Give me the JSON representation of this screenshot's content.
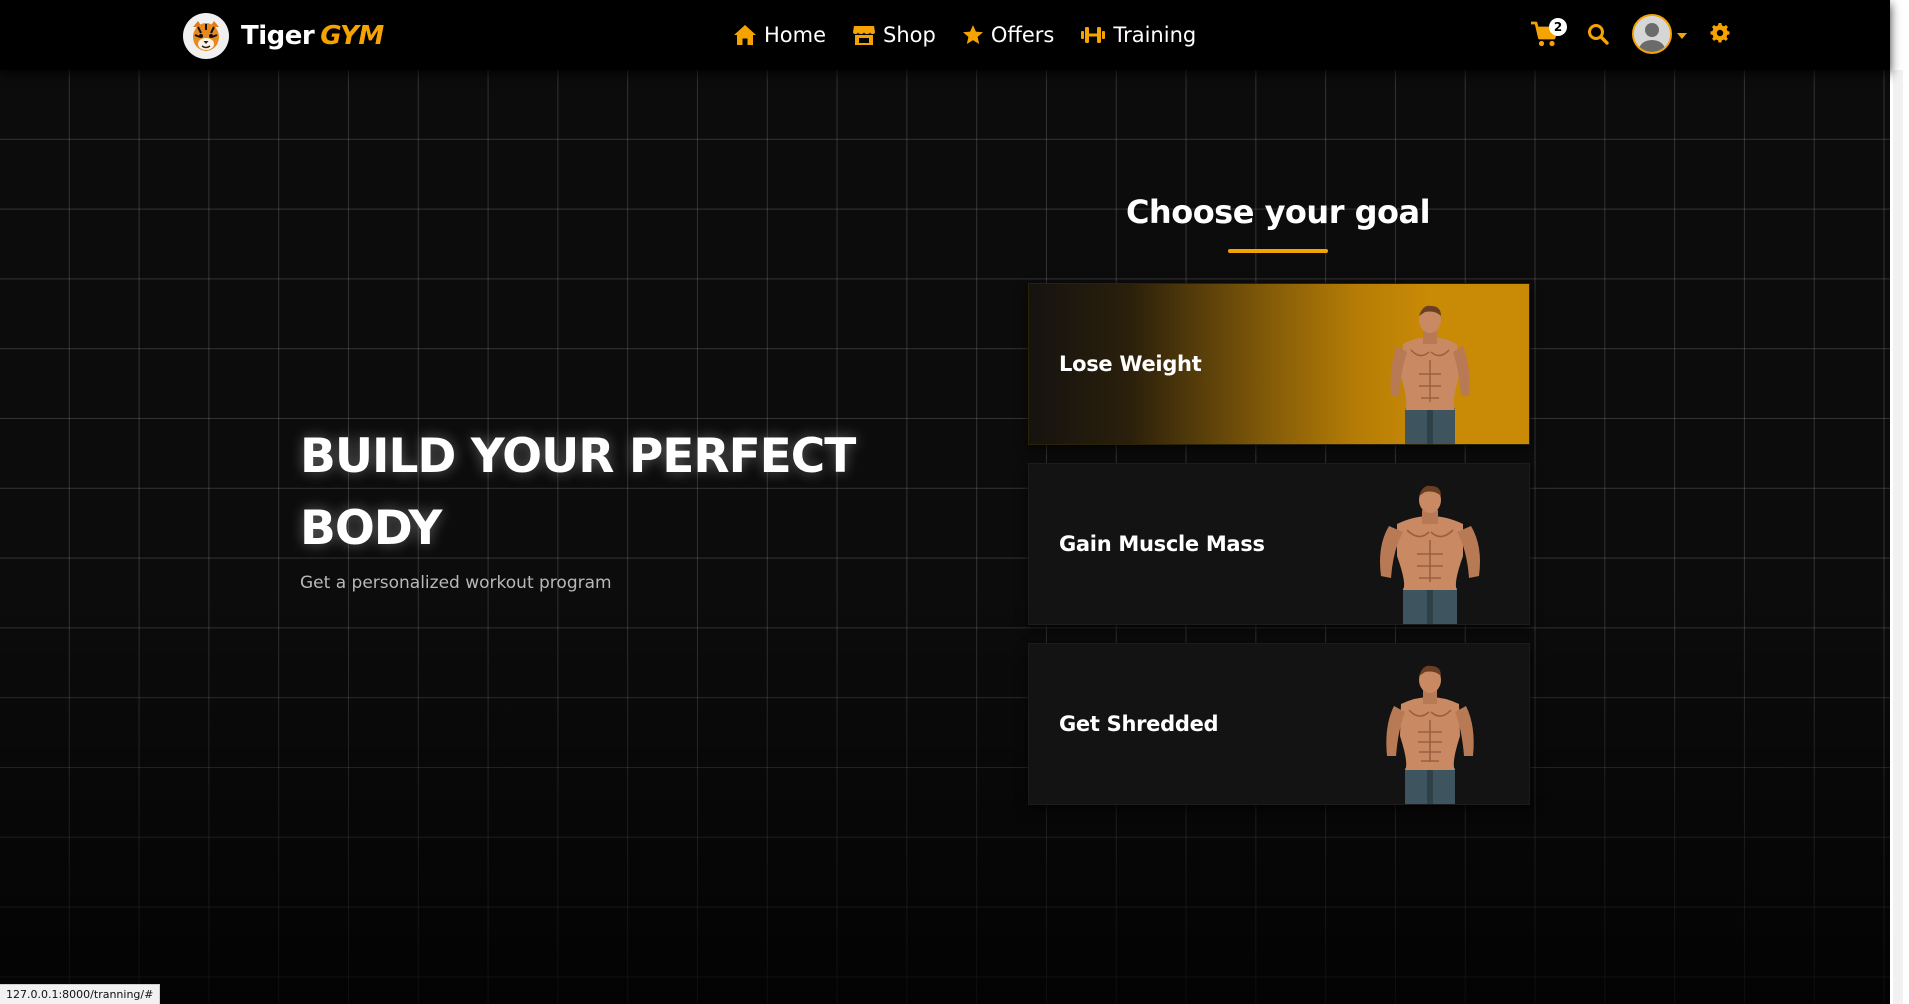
{
  "brand": {
    "name": "Tiger",
    "accent": "GYM",
    "logo_icon": "tiger-head-icon"
  },
  "nav": {
    "items": [
      {
        "label": "Home",
        "icon": "home-icon"
      },
      {
        "label": "Shop",
        "icon": "store-icon"
      },
      {
        "label": "Offers",
        "icon": "star-icon"
      },
      {
        "label": "Training",
        "icon": "dumbbell-icon"
      }
    ]
  },
  "header": {
    "cart_count": "2",
    "cart_icon": "cart-icon",
    "search_icon": "search-icon",
    "avatar_icon": "user-avatar-icon",
    "settings_icon": "gear-icon"
  },
  "hero": {
    "title_line1": "BUILD YOUR PERFECT",
    "title_line2": "BODY",
    "subtitle": "Get a personalized workout program"
  },
  "goals": {
    "heading": "Choose your goal",
    "items": [
      {
        "label": "Lose Weight",
        "active": true
      },
      {
        "label": "Gain Muscle Mass",
        "active": false
      },
      {
        "label": "Get Shredded",
        "active": false
      }
    ]
  },
  "status_bar": {
    "url": "127.0.0.1:8000/tranning/#"
  },
  "colors": {
    "accent": "#f5a300",
    "background": "#0b0b0b",
    "card": "#131313"
  }
}
